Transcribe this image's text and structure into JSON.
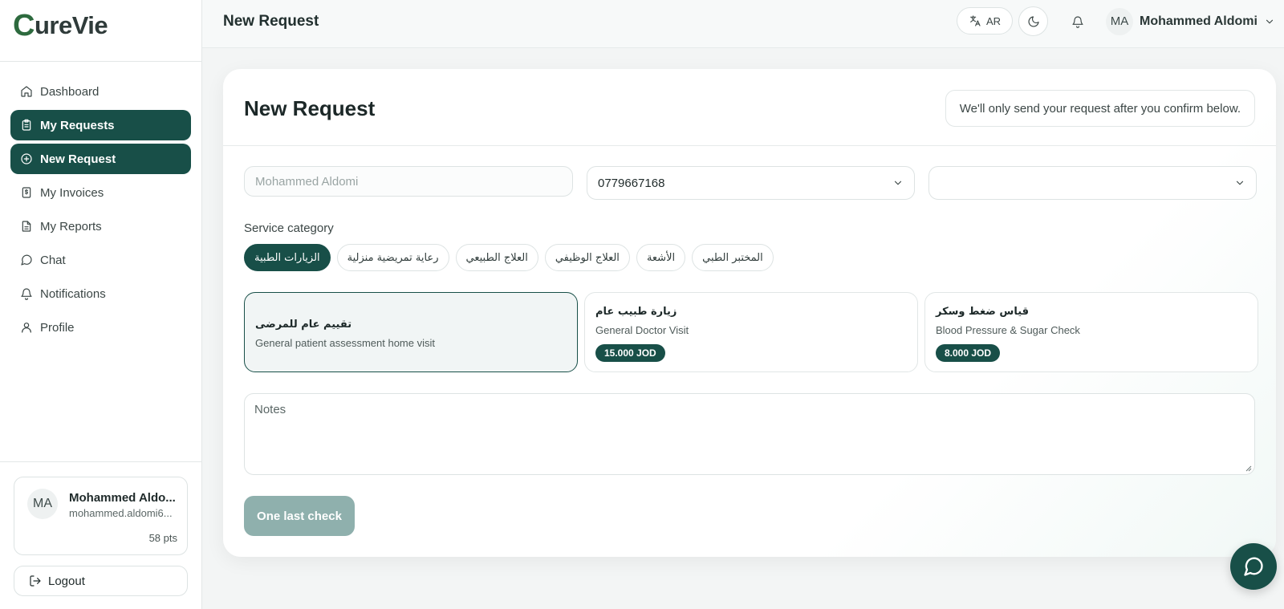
{
  "brand": {
    "logo_text": "CureVie",
    "logo_first": "C",
    "logo_rest": "ureVie"
  },
  "sidebar": {
    "items": [
      {
        "label": "Dashboard",
        "icon": "home-icon",
        "active": false
      },
      {
        "label": "My Requests",
        "icon": "clipboard-icon",
        "active": true
      },
      {
        "label": "New Request",
        "icon": "plus-circle-icon",
        "active": true
      },
      {
        "label": "My Invoices",
        "icon": "invoice-icon",
        "active": false
      },
      {
        "label": "My Reports",
        "icon": "file-text-icon",
        "active": false
      },
      {
        "label": "Chat",
        "icon": "message-circle-icon",
        "active": false
      },
      {
        "label": "Notifications",
        "icon": "bell-icon",
        "active": false
      },
      {
        "label": "Profile",
        "icon": "user-icon",
        "active": false
      }
    ],
    "user": {
      "initials": "MA",
      "name": "Mohammed Aldo...",
      "email": "mohammed.aldomi6...",
      "points": "58 pts"
    },
    "logout_label": "Logout"
  },
  "topbar": {
    "title": "New Request",
    "lang_label": "AR",
    "user_initials": "MA",
    "user_name": "Mohammed Aldomi"
  },
  "form": {
    "title": "New Request",
    "confirm_note": "We'll only send your request after you confirm below.",
    "name_placeholder": "Mohammed Aldomi",
    "phone_value": "0779667168",
    "third_select_value": "",
    "service_category_label": "Service category",
    "categories": [
      {
        "label": "الزيارات الطبية",
        "active": true
      },
      {
        "label": "رعاية تمريضية منزلية",
        "active": false
      },
      {
        "label": "العلاج الطبيعي",
        "active": false
      },
      {
        "label": "العلاج الوظيفي",
        "active": false
      },
      {
        "label": "الأشعة",
        "active": false
      },
      {
        "label": "المختبر الطبي",
        "active": false
      }
    ],
    "services": [
      {
        "title_ar": "تقييم عام للمرضى",
        "title_en": "General patient assessment home visit",
        "price": "",
        "selected": true
      },
      {
        "title_ar": "زيارة طبيب عام",
        "title_en": "General Doctor Visit",
        "price": "15.000 JOD",
        "selected": false
      },
      {
        "title_ar": "قياس ضغط وسكر",
        "title_en": "Blood Pressure & Sugar Check",
        "price": "8.000 JOD",
        "selected": false
      }
    ],
    "notes_placeholder": "Notes",
    "submit_label": "One last check"
  },
  "colors": {
    "primary": "#184f48",
    "disabled_button": "#8fb0ad",
    "brand_green": "#2d6a3e"
  }
}
